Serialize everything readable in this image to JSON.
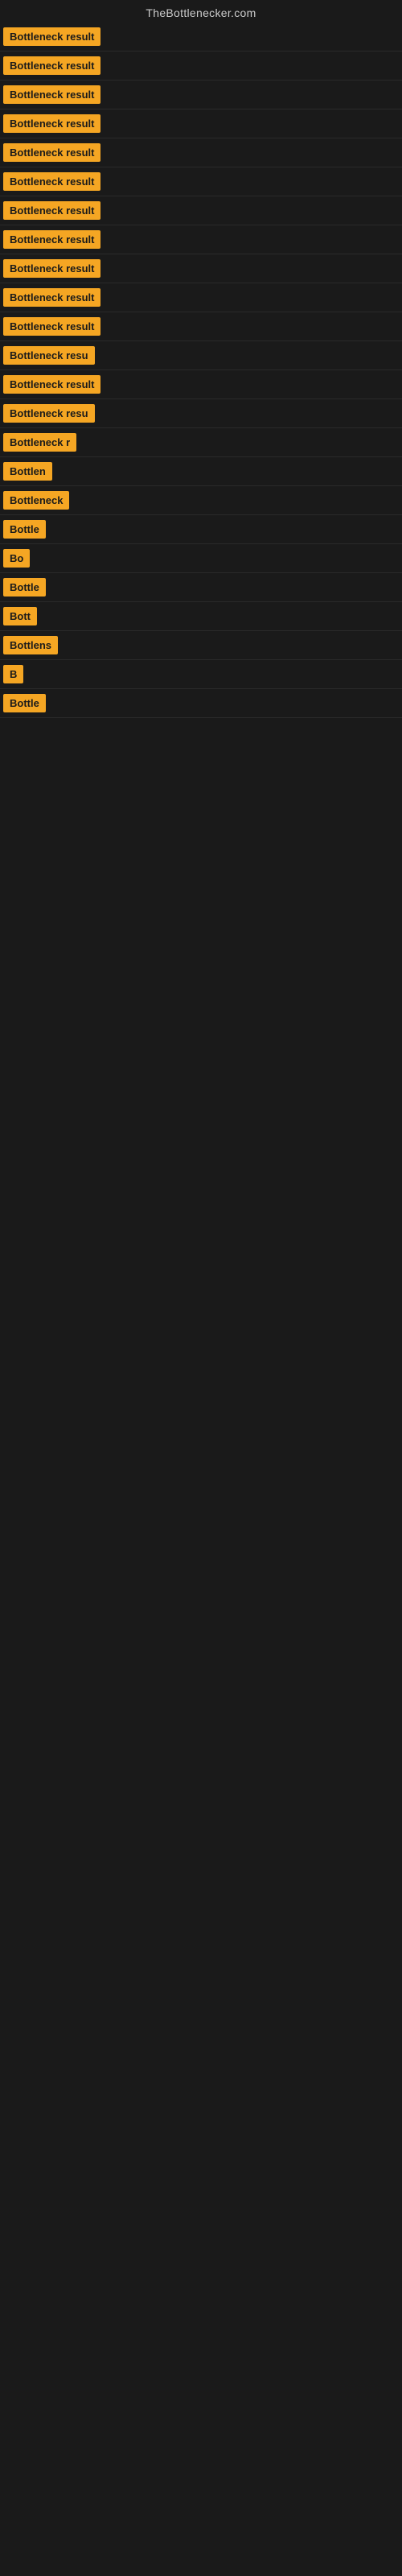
{
  "header": {
    "title": "TheBottlenecker.com"
  },
  "rows": [
    {
      "id": 1,
      "label": "Bottleneck result",
      "visible_text": "Bottleneck result"
    },
    {
      "id": 2,
      "label": "Bottleneck result",
      "visible_text": "Bottleneck result"
    },
    {
      "id": 3,
      "label": "Bottleneck result",
      "visible_text": "Bottleneck result"
    },
    {
      "id": 4,
      "label": "Bottleneck result",
      "visible_text": "Bottleneck result"
    },
    {
      "id": 5,
      "label": "Bottleneck result",
      "visible_text": "Bottleneck result"
    },
    {
      "id": 6,
      "label": "Bottleneck result",
      "visible_text": "Bottleneck result"
    },
    {
      "id": 7,
      "label": "Bottleneck result",
      "visible_text": "Bottleneck result"
    },
    {
      "id": 8,
      "label": "Bottleneck result",
      "visible_text": "Bottleneck result"
    },
    {
      "id": 9,
      "label": "Bottleneck result",
      "visible_text": "Bottleneck result"
    },
    {
      "id": 10,
      "label": "Bottleneck result",
      "visible_text": "Bottleneck result"
    },
    {
      "id": 11,
      "label": "Bottleneck result",
      "visible_text": "Bottleneck result"
    },
    {
      "id": 12,
      "label": "Bottleneck resu",
      "visible_text": "Bottleneck resu"
    },
    {
      "id": 13,
      "label": "Bottleneck result",
      "visible_text": "Bottleneck result"
    },
    {
      "id": 14,
      "label": "Bottleneck resu",
      "visible_text": "Bottleneck resu"
    },
    {
      "id": 15,
      "label": "Bottleneck r",
      "visible_text": "Bottleneck r"
    },
    {
      "id": 16,
      "label": "Bottlen",
      "visible_text": "Bottlen"
    },
    {
      "id": 17,
      "label": "Bottleneck",
      "visible_text": "Bottleneck"
    },
    {
      "id": 18,
      "label": "Bottle",
      "visible_text": "Bottle"
    },
    {
      "id": 19,
      "label": "Bo",
      "visible_text": "Bo"
    },
    {
      "id": 20,
      "label": "Bottle",
      "visible_text": "Bottle"
    },
    {
      "id": 21,
      "label": "Bott",
      "visible_text": "Bott"
    },
    {
      "id": 22,
      "label": "Bottlens",
      "visible_text": "Bottlens"
    },
    {
      "id": 23,
      "label": "B",
      "visible_text": "B"
    },
    {
      "id": 24,
      "label": "Bottle",
      "visible_text": "Bottle"
    }
  ],
  "badge_color": "#f5a623"
}
